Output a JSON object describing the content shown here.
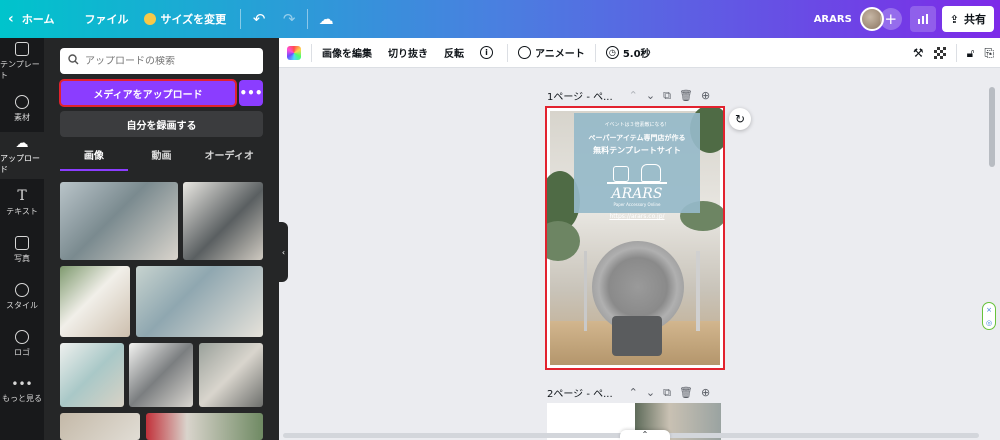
{
  "topbar": {
    "home": "ホーム",
    "file": "ファイル",
    "resize": "サイズを変更",
    "team": "ARARS",
    "share": "共有"
  },
  "rail": [
    {
      "label": "テンプレート",
      "icon": "template-icon"
    },
    {
      "label": "素材",
      "icon": "elements-icon"
    },
    {
      "label": "アップロード",
      "icon": "upload-cloud-icon"
    },
    {
      "label": "テキスト",
      "icon": "text-icon"
    },
    {
      "label": "写真",
      "icon": "photo-icon"
    },
    {
      "label": "スタイル",
      "icon": "style-icon"
    },
    {
      "label": "ロゴ",
      "icon": "logo-icon"
    },
    {
      "label": "もっと見る",
      "icon": "more-icon"
    }
  ],
  "panel": {
    "search_placeholder": "アップロードの検索",
    "upload": "メディアをアップロード",
    "record": "自分を録画する",
    "tabs": [
      "画像",
      "動画",
      "オーディオ"
    ]
  },
  "toolbar": {
    "edit_image": "画像を編集",
    "crop": "切り抜き",
    "flip": "反転",
    "animate": "アニメート",
    "duration": "5.0秒"
  },
  "pages": {
    "page1_label": "1ページ - ペ...",
    "page2_label": "2ページ - ペ..."
  },
  "card": {
    "line1": "イベントは３倍素敵になる！",
    "line2": "ペーパーアイテム専門店が作る",
    "line3": "無料テンプレートサイト",
    "brand": "ARARS",
    "sub": "Paper Accessory Online",
    "url": "https://arars.co.jp/"
  },
  "colors": {
    "accent": "#8b3dff",
    "highlight": "#e2222e"
  }
}
